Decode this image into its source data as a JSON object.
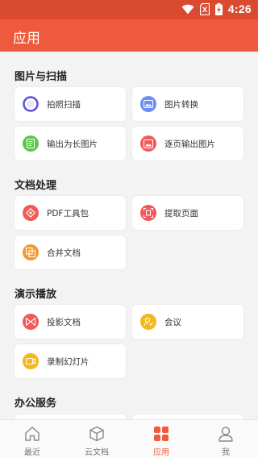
{
  "status_bar": {
    "time": "4:26"
  },
  "app_bar": {
    "title": "应用"
  },
  "sections": [
    {
      "title": "图片与扫描",
      "items": [
        {
          "label": "拍照扫描",
          "icon": "scan-camera-icon",
          "color": "#5b4fd9"
        },
        {
          "label": "图片转换",
          "icon": "image-convert-icon",
          "color": "#6b8ef0"
        },
        {
          "label": "输出为长图片",
          "icon": "long-image-icon",
          "color": "#5cc64a"
        },
        {
          "label": "逐页输出图片",
          "icon": "page-image-icon",
          "color": "#f25a5a"
        }
      ]
    },
    {
      "title": "文档处理",
      "items": [
        {
          "label": "PDF工具包",
          "icon": "pdf-toolkit-icon",
          "color": "#f25a5a"
        },
        {
          "label": "提取页面",
          "icon": "extract-page-icon",
          "color": "#f25a5a"
        },
        {
          "label": "合并文档",
          "icon": "merge-docs-icon",
          "color": "#f29a2e"
        }
      ]
    },
    {
      "title": "演示播放",
      "items": [
        {
          "label": "投影文档",
          "icon": "project-doc-icon",
          "color": "#f25a5a"
        },
        {
          "label": "会议",
          "icon": "meeting-icon",
          "color": "#f2b81c"
        },
        {
          "label": "录制幻灯片",
          "icon": "record-slides-icon",
          "color": "#f2b81c"
        }
      ]
    },
    {
      "title": "办公服务",
      "items": []
    }
  ],
  "tabs": [
    {
      "label": "最近",
      "icon": "home-icon",
      "active": false
    },
    {
      "label": "云文档",
      "icon": "cube-icon",
      "active": false
    },
    {
      "label": "应用",
      "icon": "apps-grid-icon",
      "active": true
    },
    {
      "label": "我",
      "icon": "person-icon",
      "active": false
    }
  ],
  "colors": {
    "accent": "#ef5a3c",
    "status_bar": "#d94a30",
    "background": "#f3f3f3"
  }
}
